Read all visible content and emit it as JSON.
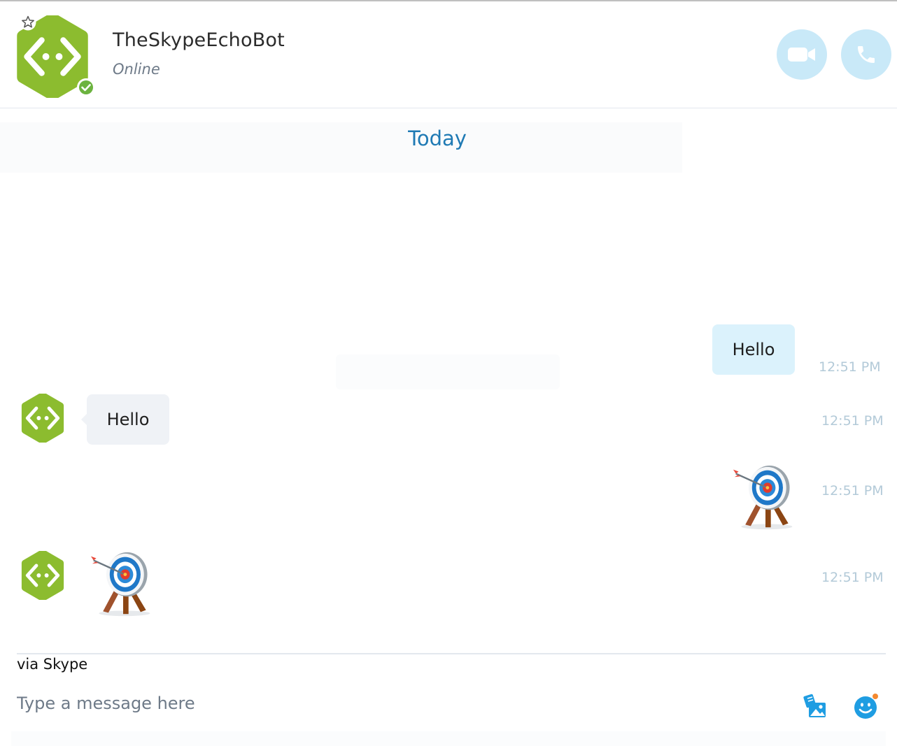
{
  "header": {
    "contact_name": "TheSkypeEchoBot",
    "contact_status": "Online",
    "avatar_icon": "bot-code-icon",
    "status_icon": "online-check-icon",
    "favorite_icon": "star-outline-icon",
    "video_call_icon": "video-camera-icon",
    "audio_call_icon": "phone-icon"
  },
  "chat": {
    "date_separator": "Today",
    "messages": [
      {
        "direction": "outgoing",
        "type": "text",
        "text": "Hello",
        "time": "12:51 PM"
      },
      {
        "direction": "incoming",
        "type": "text",
        "text": "Hello",
        "time": "12:51 PM"
      },
      {
        "direction": "outgoing",
        "type": "emoticon",
        "emoticon": "target-bullseye-icon",
        "time": "12:51 PM"
      },
      {
        "direction": "incoming",
        "type": "emoticon",
        "emoticon": "target-bullseye-icon",
        "time": "12:51 PM"
      }
    ]
  },
  "composer": {
    "via_label": "via Skype",
    "placeholder": "Type a message here",
    "media_icon": "media-gallery-icon",
    "emoticon_icon": "emoticon-icon"
  },
  "colors": {
    "accent_blue": "#1f7ab4",
    "bot_green": "#8cbc2f",
    "outgoing_bubble": "#dbf2fc",
    "incoming_bubble": "#eff2f6",
    "call_button": "#c9e9f8",
    "timestamp": "#b3cad8"
  }
}
